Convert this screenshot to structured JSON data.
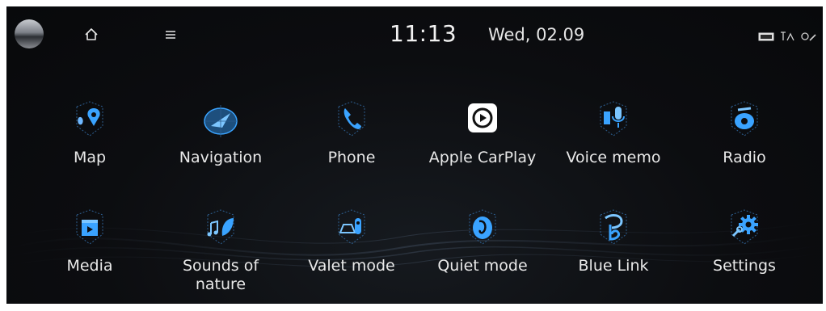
{
  "header": {
    "home_icon": "home-icon",
    "menu_icon": "menu-icon",
    "time": "11:13",
    "date": "Wed, 02.09",
    "status_icons": [
      "live-badge",
      "signal-icon",
      "wireless-icon"
    ]
  },
  "apps": [
    {
      "label": "Map",
      "icon": "map-pin-icon"
    },
    {
      "label": "Navigation",
      "icon": "navigation-icon"
    },
    {
      "label": "Phone",
      "icon": "phone-icon"
    },
    {
      "label": "Apple CarPlay",
      "icon": "carplay-icon"
    },
    {
      "label": "Voice memo",
      "icon": "microphone-icon"
    },
    {
      "label": "Radio",
      "icon": "radio-icon"
    },
    {
      "label": "Media",
      "icon": "media-icon"
    },
    {
      "label": "Sounds of nature",
      "icon": "leaf-icon"
    },
    {
      "label": "Valet mode",
      "icon": "valet-icon"
    },
    {
      "label": "Quiet mode",
      "icon": "quiet-icon"
    },
    {
      "label": "Blue Link",
      "icon": "bluelink-icon"
    },
    {
      "label": "Settings",
      "icon": "gear-icon"
    }
  ],
  "colors": {
    "accent": "#3aa3ff",
    "accent_light": "#7cc6ff",
    "background": "#0c0d10",
    "text": "#e9e9e9"
  }
}
